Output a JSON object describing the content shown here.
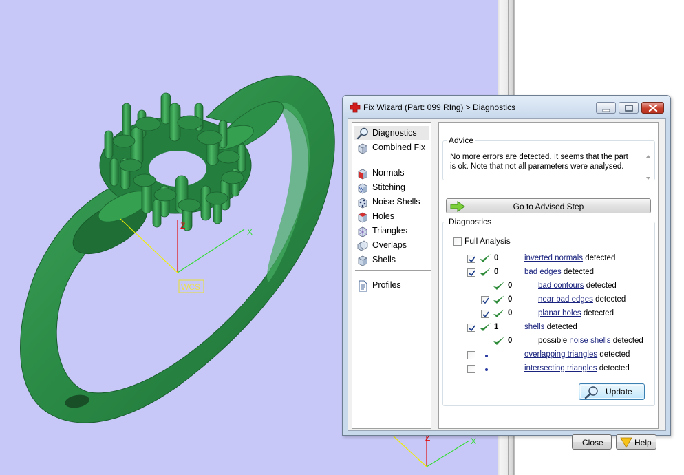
{
  "viewport": {
    "background": "#c8c8f8",
    "model_color": "#2e8b4a",
    "axis_labels": {
      "x": "X",
      "z": "Z"
    },
    "wcs_label": "WCS"
  },
  "wizard": {
    "title": "Fix Wizard (Part: 099 RIng) > Diagnostics",
    "title_icon": "red-cross-icon",
    "nav_groups": [
      [
        {
          "label": "Diagnostics",
          "icon": "magnifier-icon",
          "selected": true
        },
        {
          "label": "Combined Fix",
          "icon": "cube-stack-icon"
        }
      ],
      [
        {
          "label": "Normals",
          "icon": "normals-cube-icon"
        },
        {
          "label": "Stitching",
          "icon": "stitching-cube-icon"
        },
        {
          "label": "Noise Shells",
          "icon": "noise-shells-icon"
        },
        {
          "label": "Holes",
          "icon": "holes-cube-icon"
        },
        {
          "label": "Triangles",
          "icon": "triangles-cube-icon"
        },
        {
          "label": "Overlaps",
          "icon": "overlaps-icon"
        },
        {
          "label": "Shells",
          "icon": "shells-icon"
        }
      ],
      [
        {
          "label": "Profiles",
          "icon": "profile-document-icon"
        }
      ]
    ],
    "advice": {
      "title": "Advice",
      "text": "No more errors are detected. It seems that the part is ok. Note that not all parameters were analysed."
    },
    "goto_button": "Go to Advised Step",
    "diagnostics": {
      "title": "Diagnostics",
      "full_analysis_label": "Full Analysis",
      "full_analysis_checked": false,
      "detected_word": "detected",
      "rows": [
        {
          "checkbox": true,
          "checked": true,
          "status": "ok",
          "count": "0",
          "prefix": "",
          "link": "inverted normals",
          "level": 0
        },
        {
          "checkbox": true,
          "checked": true,
          "status": "ok",
          "count": "0",
          "prefix": "",
          "link": "bad edges",
          "level": 0
        },
        {
          "checkbox": false,
          "checked": false,
          "status": "ok",
          "count": "0",
          "prefix": "",
          "link": "bad contours",
          "level": 1
        },
        {
          "checkbox": true,
          "checked": true,
          "status": "ok",
          "count": "0",
          "prefix": "",
          "link": "near bad edges",
          "level": 1
        },
        {
          "checkbox": true,
          "checked": true,
          "status": "ok",
          "count": "0",
          "prefix": "",
          "link": "planar holes",
          "level": 1
        },
        {
          "checkbox": true,
          "checked": true,
          "status": "ok",
          "count": "1",
          "prefix": "",
          "link": "shells",
          "level": 0
        },
        {
          "checkbox": false,
          "checked": false,
          "status": "ok",
          "count": "0",
          "prefix": "possible ",
          "link": "noise shells",
          "level": 1
        },
        {
          "checkbox": true,
          "checked": false,
          "status": "none",
          "count": "",
          "prefix": "",
          "link": "overlapping triangles",
          "level": 0
        },
        {
          "checkbox": true,
          "checked": false,
          "status": "none",
          "count": "",
          "prefix": "",
          "link": "intersecting triangles",
          "level": 0
        }
      ]
    },
    "update_button": "Update",
    "close_button": "Close",
    "help_button": "Help",
    "colors": {
      "link": "#1a237e",
      "check": "#2e8b3a",
      "frame": "#c9d9ec"
    }
  }
}
